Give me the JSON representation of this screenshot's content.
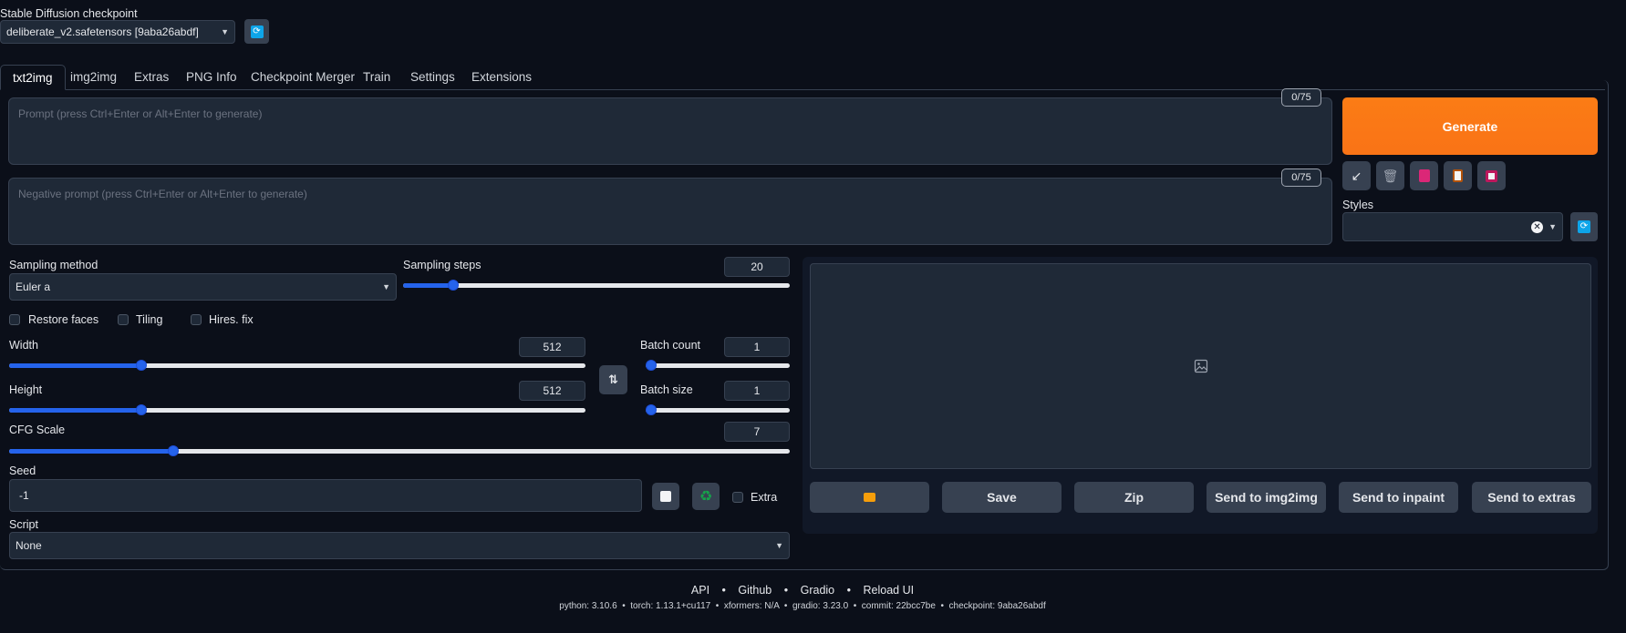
{
  "checkpoint": {
    "label": "Stable Diffusion checkpoint",
    "value": "deliberate_v2.safetensors [9aba26abdf]"
  },
  "tabs": [
    "txt2img",
    "img2img",
    "Extras",
    "PNG Info",
    "Checkpoint Merger",
    "Train",
    "Settings",
    "Extensions"
  ],
  "prompt": {
    "placeholder": "Prompt (press Ctrl+Enter or Alt+Enter to generate)",
    "counter": "0/75"
  },
  "negative_prompt": {
    "placeholder": "Negative prompt (press Ctrl+Enter or Alt+Enter to generate)",
    "counter": "0/75"
  },
  "generate_label": "Generate",
  "styles_label": "Styles",
  "sampling": {
    "method_label": "Sampling method",
    "method_value": "Euler a",
    "steps_label": "Sampling steps",
    "steps_value": "20",
    "steps_fraction": 0.13
  },
  "checkboxes": {
    "restore_faces": "Restore faces",
    "tiling": "Tiling",
    "hires_fix": "Hires. fix"
  },
  "width": {
    "label": "Width",
    "value": "512",
    "fraction": 0.23
  },
  "height": {
    "label": "Height",
    "value": "512",
    "fraction": 0.23
  },
  "batch_count": {
    "label": "Batch count",
    "value": "1",
    "fraction": 0.0
  },
  "batch_size": {
    "label": "Batch size",
    "value": "1",
    "fraction": 0.0
  },
  "cfg": {
    "label": "CFG Scale",
    "value": "7",
    "fraction": 0.21
  },
  "seed": {
    "label": "Seed",
    "value": "-1",
    "extra_label": "Extra"
  },
  "script": {
    "label": "Script",
    "value": "None"
  },
  "output_buttons": {
    "save": "Save",
    "zip": "Zip",
    "send_img2img": "Send to img2img",
    "send_inpaint": "Send to inpaint",
    "send_extras": "Send to extras"
  },
  "footer": {
    "links": [
      "API",
      "Github",
      "Gradio",
      "Reload UI"
    ],
    "separator": "•",
    "info": "python: 3.10.6  •  torch: 1.13.1+cu117  •  xformers: N/A  •  gradio: 3.23.0  •  commit: 22bcc7be  •  checkpoint: 9aba26abdf"
  },
  "colors": {
    "background": "#0b0f19",
    "accent_orange": "#f97316",
    "slider_blue": "#2563eb",
    "refresh_blue": "#0ea5e9"
  }
}
